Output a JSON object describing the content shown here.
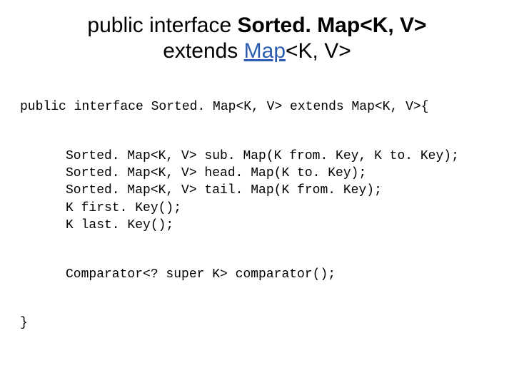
{
  "title": {
    "line1a": "public interface ",
    "line1b": "Sorted. Map<K, V>",
    "line2a": "extends ",
    "line2link": "Map",
    "line2b": "<K, V>"
  },
  "code": {
    "decl": "public interface Sorted. Map<K, V> extends Map<K, V>{",
    "m1": "Sorted. Map<K, V> sub. Map(K from. Key, K to. Key);",
    "m2": "Sorted. Map<K, V> head. Map(K to. Key);",
    "m3": "Sorted. Map<K, V> tail. Map(K from. Key);",
    "m4": "K first. Key();",
    "m5": "K last. Key();",
    "m6": "Comparator<? super K> comparator();",
    "close": "}"
  }
}
